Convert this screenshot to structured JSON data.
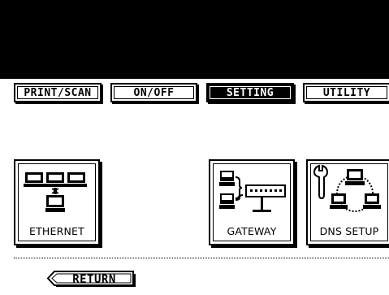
{
  "tabs": [
    {
      "label": "PRINT/SCAN",
      "active": false
    },
    {
      "label": "ON/OFF",
      "active": false
    },
    {
      "label": "SETTING",
      "active": true
    },
    {
      "label": "UTILITY",
      "active": false
    }
  ],
  "buttons": {
    "ethernet": "ETHERNET",
    "gateway": "GATEWAY",
    "dns_setup": "DNS SETUP"
  },
  "return_label": "RETURN",
  "colors": {
    "background": "#000000",
    "panel": "#ffffff",
    "ink": "#000000"
  }
}
